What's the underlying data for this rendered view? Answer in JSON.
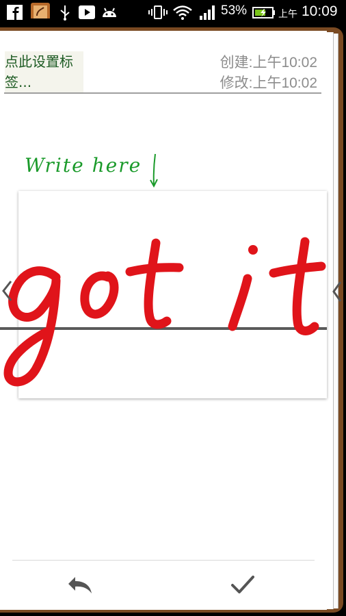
{
  "status_bar": {
    "battery": "53%",
    "ampm": "上午",
    "time": "10:09",
    "icons": [
      "facebook-icon",
      "app-icon",
      "usb-icon",
      "play-store-icon",
      "android-icon",
      "vibrate-icon",
      "wifi-icon",
      "signal-icon",
      "battery-icon"
    ]
  },
  "note": {
    "title_placeholder": "点此设置标签...",
    "created": "创建:上午10:02",
    "modified": "修改:上午10:02",
    "hint": "Write here",
    "handwriting": "got it"
  },
  "colors": {
    "ink": "#e0141a",
    "hint": "#1a9a2a",
    "title": "#1c5a22",
    "wood": "#7a4a22"
  },
  "toolbar": {
    "undo_icon": "undo-icon",
    "confirm_icon": "check-icon"
  }
}
